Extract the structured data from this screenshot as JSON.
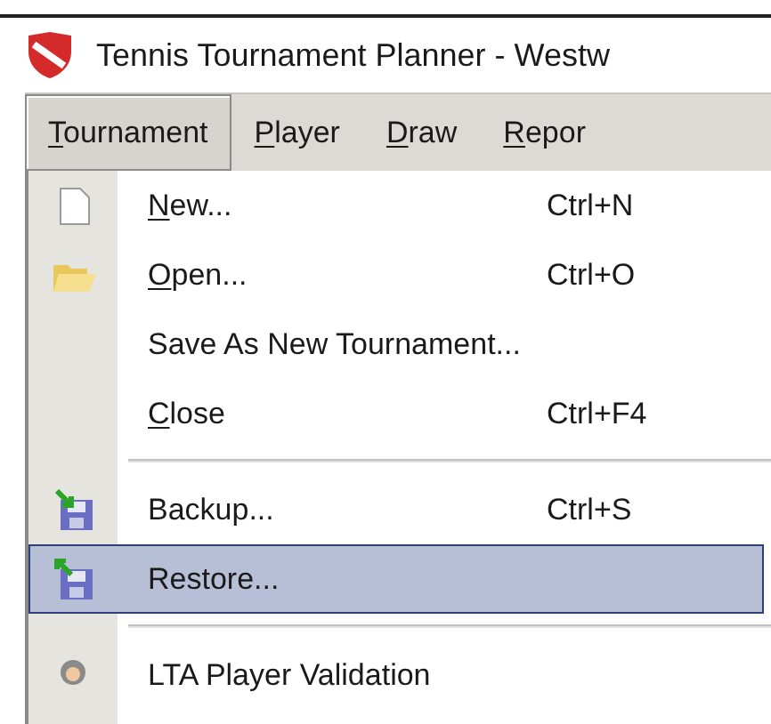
{
  "window": {
    "title": "Tennis Tournament Planner - Westw"
  },
  "menu_bar": [
    {
      "label": "Tournament",
      "underlined": true,
      "selected": true
    },
    {
      "label": "Player",
      "underlined": true,
      "selected": false
    },
    {
      "label": "Draw",
      "underlined": true,
      "selected": false
    },
    {
      "label": "Repor",
      "underlined": true,
      "selected": false
    }
  ],
  "menu": [
    {
      "kind": "item",
      "label": "New...",
      "underlined": true,
      "shortcut": "Ctrl+N",
      "selected": false
    },
    {
      "kind": "item",
      "label": "Open...",
      "underlined": true,
      "shortcut": "Ctrl+O",
      "selected": false
    },
    {
      "kind": "item",
      "label": "Save As New Tournament...",
      "underlined": false,
      "selected": false
    },
    {
      "kind": "item",
      "label": "Close",
      "underlined": true,
      "shortcut": "Ctrl+F4",
      "selected": false
    },
    {
      "kind": "separator"
    },
    {
      "kind": "item",
      "label": "Backup...",
      "underlined": false,
      "shortcut": "Ctrl+S",
      "selected": false
    },
    {
      "kind": "item",
      "label": "Restore...",
      "underlined": false,
      "selected": true
    },
    {
      "kind": "separator"
    },
    {
      "kind": "item",
      "label": "LTA Player Validation",
      "underlined": false,
      "selected": false
    }
  ]
}
